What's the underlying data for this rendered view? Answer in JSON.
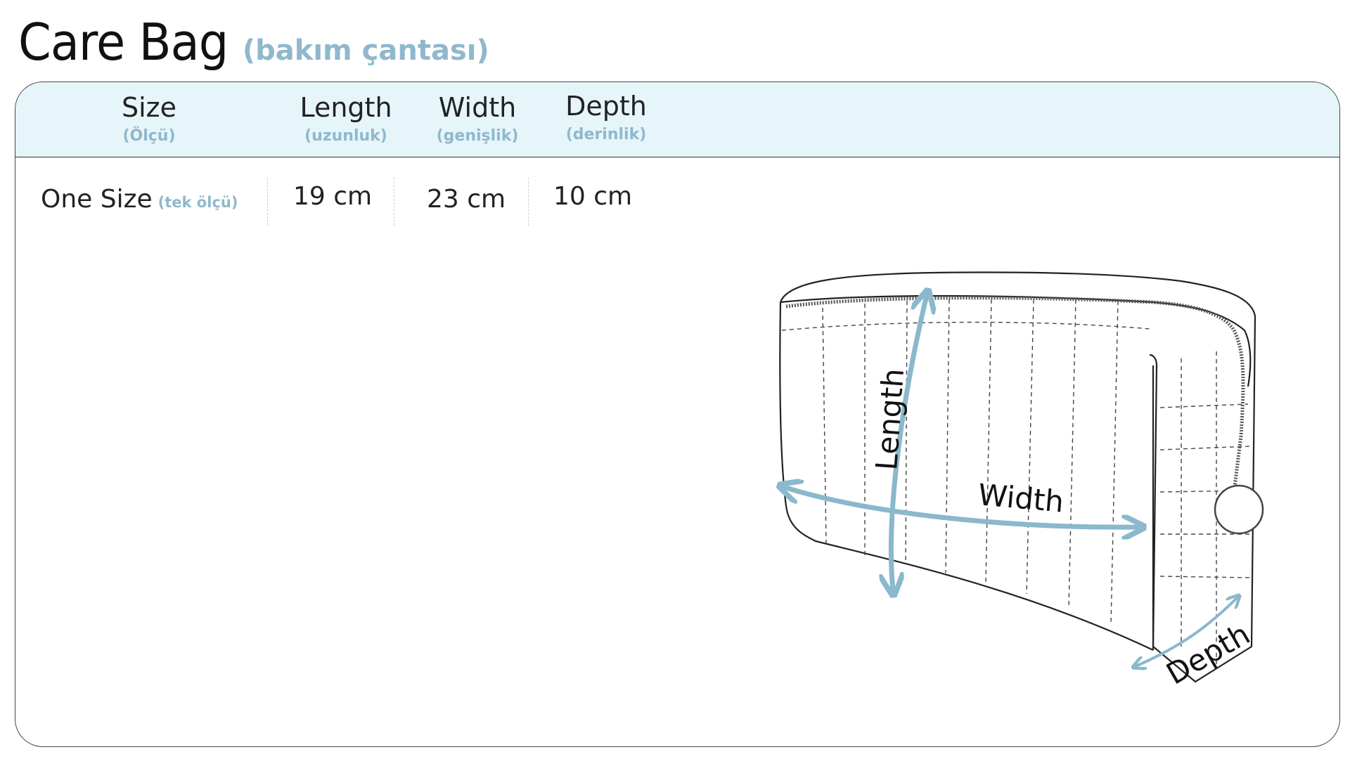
{
  "title": {
    "main": "Care Bag",
    "sub": "(bakım çantası)"
  },
  "table": {
    "headers": [
      {
        "label": "Size",
        "sub": "(Ölçü)"
      },
      {
        "label": "Length",
        "sub": "(uzunluk)"
      },
      {
        "label": "Width",
        "sub": "(genişlik)"
      },
      {
        "label": "Depth",
        "sub": "(derinlik)"
      }
    ],
    "row": {
      "size": "One Size",
      "size_sub": "(tek ölçü)",
      "length": "19 cm",
      "width": "23 cm",
      "depth": "10 cm"
    }
  },
  "diagram": {
    "labels": {
      "length": "Length",
      "width": "Width",
      "depth": "Depth"
    },
    "arrow_color": "#8ab8cd"
  }
}
